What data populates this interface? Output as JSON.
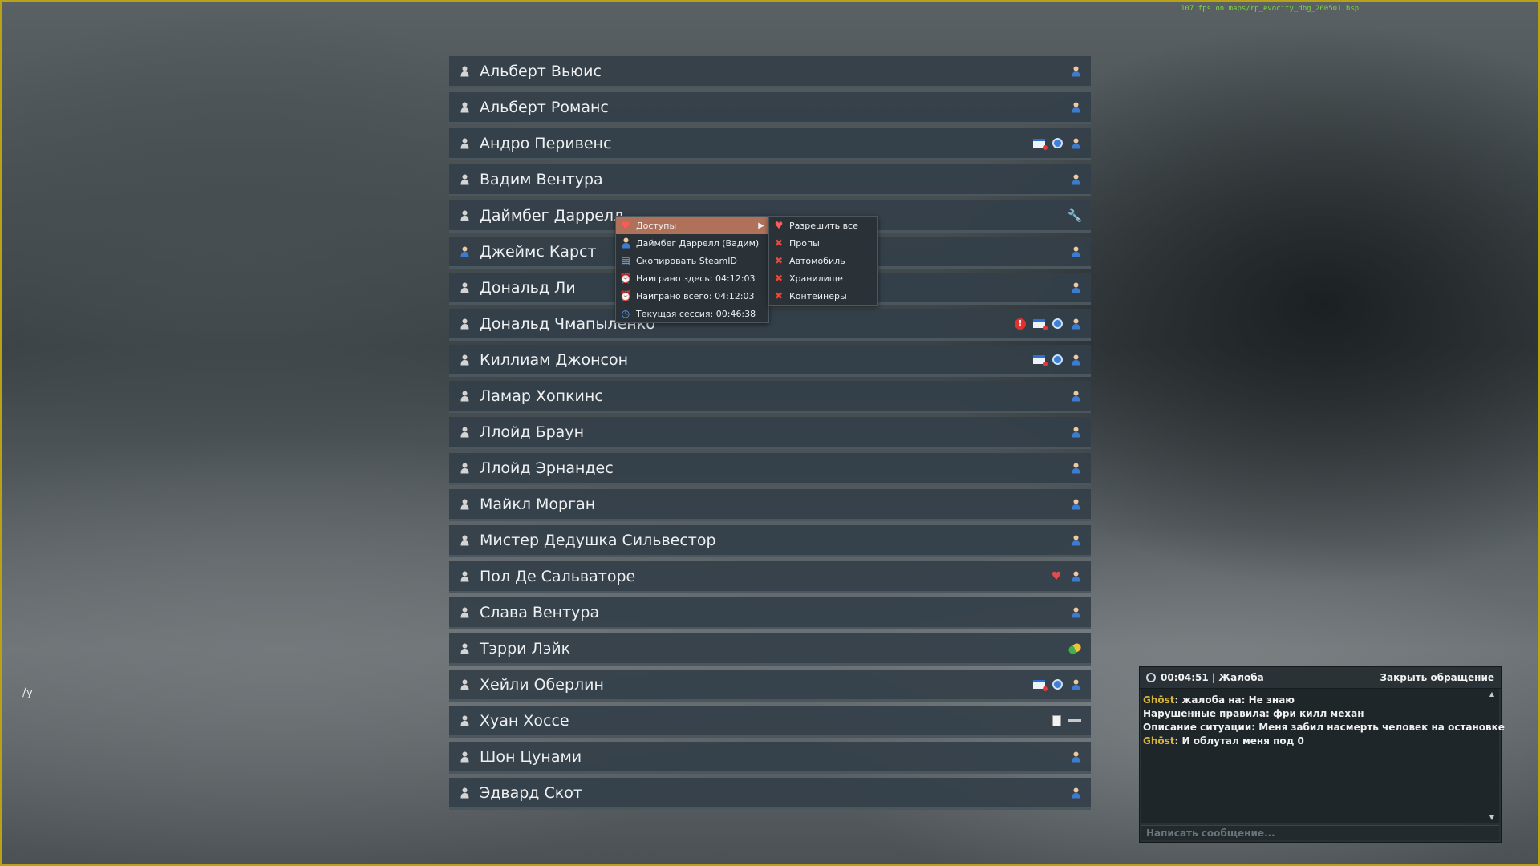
{
  "hud": {
    "fps_text": "107 fps on maps/rp_evocity_dbg_260501.bsp",
    "console_text": "/y"
  },
  "players": [
    {
      "name": "Альберт Вьюис",
      "icons": [
        "user-icon"
      ]
    },
    {
      "name": "Альберт Романс",
      "icons": [
        "user-icon"
      ]
    },
    {
      "name": "Андро Перивенс",
      "icons": [
        "card-icon",
        "clock-icon",
        "user-icon"
      ]
    },
    {
      "name": "Вадим Вентура",
      "icons": [
        "user-icon"
      ]
    },
    {
      "name": "Даймбег Даррелл",
      "icons": [
        "wrench-icon"
      ]
    },
    {
      "name": "Джеймс Карст",
      "icons": [
        "user-icon"
      ]
    },
    {
      "name": "Дональд Ли",
      "icons": [
        "user-icon"
      ]
    },
    {
      "name": "Дональд Чмапыленко",
      "icons": [
        "alert-icon",
        "card-icon",
        "clock-icon",
        "user-icon"
      ]
    },
    {
      "name": "Киллиам Джонсон",
      "icons": [
        "card-icon",
        "clock-icon",
        "user-icon"
      ]
    },
    {
      "name": "Ламар Хопкинс",
      "icons": [
        "user-icon"
      ]
    },
    {
      "name": "Ллойд Браун",
      "icons": [
        "user-icon"
      ]
    },
    {
      "name": "Ллойд Эрнандес",
      "icons": [
        "user-icon"
      ]
    },
    {
      "name": "Майкл Морган",
      "icons": [
        "user-icon"
      ]
    },
    {
      "name": "Мистер Дедушка Сильвестор",
      "icons": [
        "user-icon"
      ]
    },
    {
      "name": "Пол Де Сальваторе",
      "icons": [
        "heart-icon",
        "user-icon"
      ]
    },
    {
      "name": "Слава Вентура",
      "icons": [
        "user-icon"
      ]
    },
    {
      "name": "Тэрри Лэйк",
      "icons": [
        "pill-icon"
      ]
    },
    {
      "name": "Хейли Оберлин",
      "icons": [
        "card-icon",
        "clock-icon",
        "user-icon"
      ]
    },
    {
      "name": "Хуан Хоссе",
      "icons": [
        "document-icon",
        "dash-icon"
      ]
    },
    {
      "name": "Шон Цунами",
      "icons": [
        "user-icon"
      ]
    },
    {
      "name": "Эдвард Скот",
      "icons": [
        "user-icon"
      ]
    }
  ],
  "context_menu": {
    "items": [
      {
        "label": "Доступы",
        "icon": "heart-icon"
      },
      {
        "label": "Даймбег Даррелл (Вадим)",
        "icon": "user-icon"
      },
      {
        "label": "Скопировать SteamID",
        "icon": "clipboard-icon"
      },
      {
        "label": "Наиграно здесь: 04:12:03",
        "icon": "alarm-icon"
      },
      {
        "label": "Наиграно всего: 04:12:03",
        "icon": "alarm-icon"
      },
      {
        "label": "Текущая сессия: 00:46:38",
        "icon": "clock-icon"
      }
    ],
    "submenu": [
      {
        "label": "Разрешить все",
        "icon": "heart-icon"
      },
      {
        "label": "Пропы",
        "icon": "x-icon"
      },
      {
        "label": "Автомобиль",
        "icon": "x-icon"
      },
      {
        "label": "Хранилище",
        "icon": "x-icon"
      },
      {
        "label": "Контейнеры",
        "icon": "x-icon"
      }
    ]
  },
  "ticket": {
    "title": "00:04:51 | Жалоба",
    "close_label": "Закрыть обращение",
    "messages": [
      {
        "nick": "Ghöst",
        "text": ": жалоба на: Не знаю"
      },
      {
        "nick": "",
        "text": "Нарушенные правила: фри килл механ"
      },
      {
        "nick": "",
        "text": "Описание ситуации: Меня забил насмерть человек на остановке"
      },
      {
        "nick": "Ghöst",
        "text": ": И облутал меня под 0"
      }
    ],
    "input_placeholder": "Написать сообщение..."
  },
  "colors": {
    "row_bg": "#34404a",
    "menu_active": "#b0715a",
    "frame": "#b8a21a",
    "fps_text": "#7fd63a",
    "nick": "#d6b43a"
  }
}
